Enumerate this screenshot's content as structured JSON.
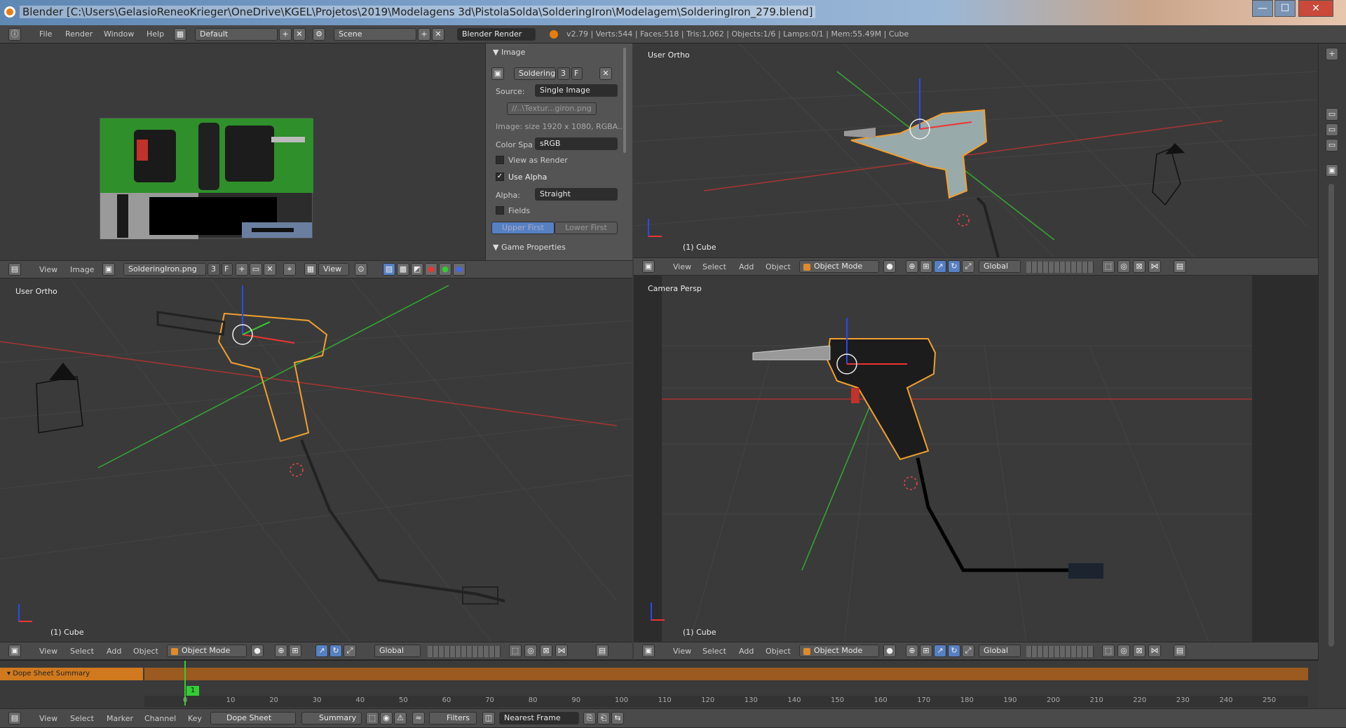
{
  "window": {
    "title": "Blender [C:\\Users\\GelasioReneoKrieger\\OneDrive\\KGEL\\Projetos\\2019\\Modelagens 3d\\PistolaSolda\\SolderingIron\\Modelagem\\SolderingIron_279.blend]",
    "minimize": "—",
    "maximize": "☐",
    "close": "✕"
  },
  "info": {
    "menus": [
      "File",
      "Render",
      "Window",
      "Help"
    ],
    "layout": "Default",
    "scene": "Scene",
    "engine": "Blender Render",
    "stats": "v2.79 | Verts:544 | Faces:518 | Tris:1,062 | Objects:1/6 | Lamps:0/1 | Mem:55.49M | Cube"
  },
  "image_editor": {
    "menus": [
      "View",
      "Image"
    ],
    "image_name": "SolderingIron.png",
    "users": "3",
    "fake": "F",
    "view_label": "View"
  },
  "image_panel": {
    "header": "Image",
    "datablock": "SolderingIr",
    "users": "3",
    "fake": "F",
    "source_label": "Source:",
    "source_value": "Single Image",
    "filepath": "//..\\Textur...giron.png",
    "info": "Image: size 1920 x 1080, RGBA...",
    "colorspace_label": "Color Spa",
    "colorspace_value": "sRGB",
    "view_as_render": "View as Render",
    "use_alpha": "Use Alpha",
    "alpha_label": "Alpha:",
    "alpha_value": "Straight",
    "fields": "Fields",
    "upper_first": "Upper First",
    "lower_first": "Lower First",
    "game_properties": "Game Properties"
  },
  "viewport_tr": {
    "label": "User Ortho",
    "object": "(1) Cube"
  },
  "viewport_bl": {
    "label": "User Ortho",
    "object": "(1) Cube"
  },
  "viewport_br": {
    "label": "Camera Persp",
    "object": "(1) Cube"
  },
  "view3d_header": {
    "menus": [
      "View",
      "Select",
      "Add",
      "Object"
    ],
    "mode": "Object Mode",
    "orientation": "Global"
  },
  "dopesheet": {
    "summary_channel": "Dope Sheet Summary",
    "current_frame": "1",
    "frame_ticks": [
      "0",
      "10",
      "20",
      "30",
      "40",
      "50",
      "60",
      "70",
      "80",
      "90",
      "100",
      "110",
      "120",
      "130",
      "140",
      "150",
      "160",
      "170",
      "180",
      "190",
      "200",
      "210",
      "220",
      "230",
      "240",
      "250"
    ],
    "menus": [
      "View",
      "Select",
      "Marker",
      "Channel",
      "Key"
    ],
    "mode": "Dope Sheet",
    "summary": "Summary",
    "filters": "Filters",
    "snap": "Nearest Frame"
  },
  "colors": {
    "accent_orange": "#e08a2c",
    "selection_outline": "#f0a030",
    "header_bg": "#4a4a4a",
    "viewport_bg": "#3a3a3a"
  }
}
